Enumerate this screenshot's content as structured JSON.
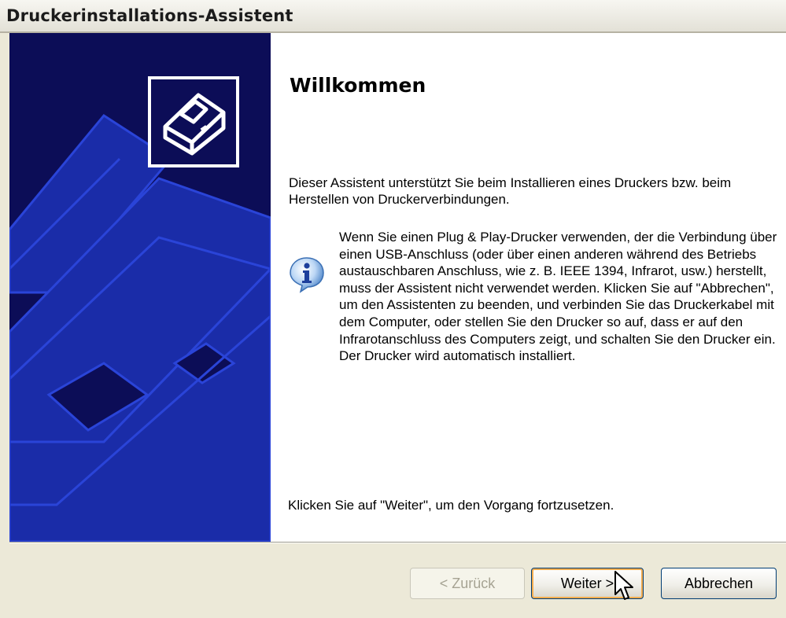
{
  "window": {
    "title": "Druckerinstallations-Assistent"
  },
  "content": {
    "heading": "Willkommen",
    "intro": "Dieser Assistent unterstützt Sie beim Installieren eines Druckers bzw. beim Herstellen von Druckerverbindungen.",
    "info_text": "Wenn Sie einen Plug & Play-Drucker verwenden, der die Verbindung über einen USB-Anschluss (oder über einen anderen während des Betriebs austauschbaren Anschluss, wie z. B. IEEE 1394, Infrarot, usw.) herstellt, muss der Assistent nicht verwendet werden. Klicken Sie auf \"Abbrechen\", um den Assistenten zu beenden, und verbinden Sie das Druckerkabel mit dem Computer, oder stellen Sie den Drucker so auf, dass er auf den Infrarotanschluss des Computers zeigt, und schalten Sie den Drucker ein. Der Drucker wird automatisch installiert.",
    "outro": "Klicken Sie auf \"Weiter\", um den Vorgang fortzusetzen."
  },
  "buttons": {
    "back": "< Zurück",
    "next": "Weiter >",
    "cancel": "Abbrechen"
  },
  "icons": {
    "wizard": "printer-icon",
    "info": "info-icon",
    "cursor": "mouse-pointer-icon"
  },
  "colors": {
    "sidebar": "#0c0d57",
    "sidebar_art": "#1a2ca8",
    "button_border": "#003c74",
    "default_highlight": "#f5ad4e"
  }
}
